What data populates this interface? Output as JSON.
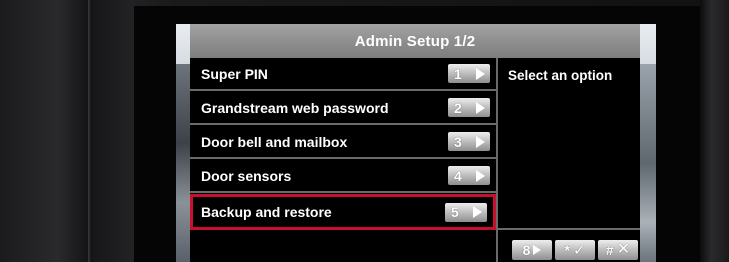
{
  "header": {
    "title": "Admin Setup 1/2"
  },
  "menu": {
    "items": [
      {
        "label": "Super PIN",
        "key": "1"
      },
      {
        "label": "Grandstream web password",
        "key": "2"
      },
      {
        "label": "Door bell and mailbox",
        "key": "3"
      },
      {
        "label": "Door sensors",
        "key": "4"
      },
      {
        "label": "Backup and restore",
        "key": "5",
        "selected": true
      }
    ]
  },
  "info": {
    "text": "Select an option"
  },
  "softkeys": {
    "next_key": "8",
    "confirm_key": "*",
    "cancel_key": "#"
  },
  "colors": {
    "selection_border": "#c8102e",
    "titlebar": "#8f8f8f"
  }
}
